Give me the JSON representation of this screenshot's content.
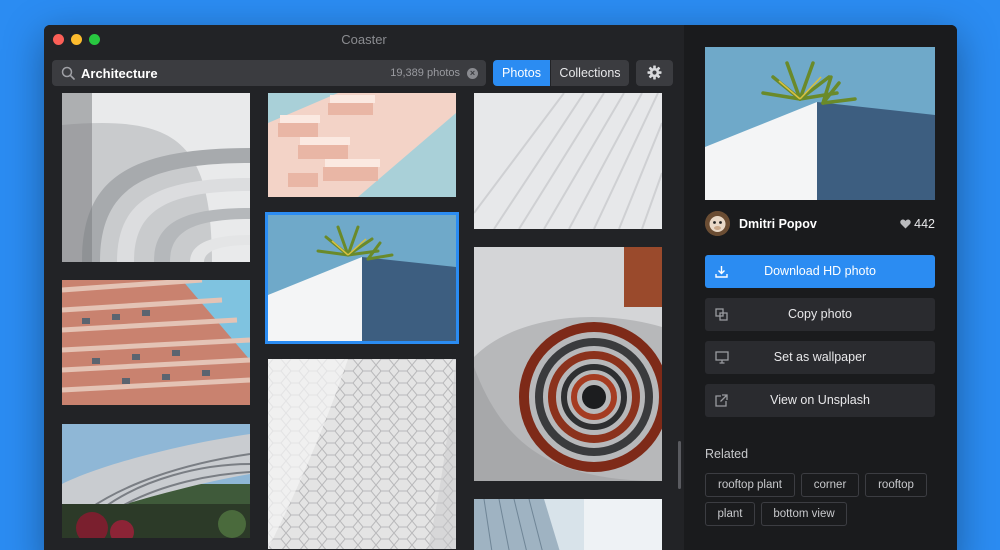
{
  "window": {
    "title": "Coaster"
  },
  "search": {
    "value": "Architecture",
    "count": "19,389 photos",
    "clear_glyph": "×"
  },
  "tabs": [
    {
      "label": "Photos",
      "active": true
    },
    {
      "label": "Collections",
      "active": false
    }
  ],
  "settings": {
    "icon": "gear-icon"
  },
  "grid": {
    "photos": [
      {
        "name": "white-curved-arches"
      },
      {
        "name": "pink-tiered-building"
      },
      {
        "name": "white-ribbed-facade"
      },
      {
        "name": "rooftop-palm-corner",
        "selected": true
      },
      {
        "name": "red-striped-tower"
      },
      {
        "name": "spiral-staircase"
      },
      {
        "name": "curved-glass-building"
      },
      {
        "name": "white-hexagon-tiles"
      },
      {
        "name": "glass-facade-partial"
      }
    ]
  },
  "detail": {
    "author": "Dmitri Popov",
    "likes": "442",
    "actions": [
      {
        "label": "Download HD photo",
        "icon": "download-icon"
      },
      {
        "label": "Copy photo",
        "icon": "copy-icon"
      },
      {
        "label": "Set as wallpaper",
        "icon": "monitor-icon"
      },
      {
        "label": "View on Unsplash",
        "icon": "external-link-icon"
      }
    ],
    "related_label": "Related",
    "tags": [
      "rooftop plant",
      "corner",
      "rooftop",
      "plant",
      "bottom view"
    ]
  },
  "colors": {
    "accent": "#2b8cf2",
    "background": "#2b8cf2",
    "panel": "#1a1b1d"
  }
}
